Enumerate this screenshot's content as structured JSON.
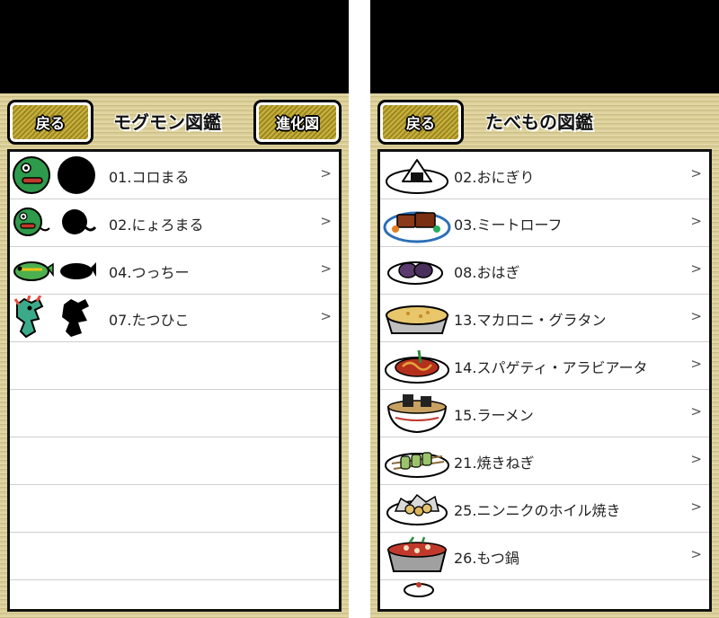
{
  "left_panel": {
    "back_label": "戻る",
    "title": "モグモン図鑑",
    "evolution_label": "進化図",
    "chevron": ">",
    "items": [
      {
        "label": "01.コロまる",
        "icon": "koromaru-icon"
      },
      {
        "label": "02.にょろまる",
        "icon": "nyoromaru-icon"
      },
      {
        "label": "04.つっちー",
        "icon": "tsucchi-icon"
      },
      {
        "label": "07.たつひこ",
        "icon": "tatsuhiko-icon"
      }
    ]
  },
  "right_panel": {
    "back_label": "戻る",
    "title": "たべもの図鑑",
    "chevron": ">",
    "items": [
      {
        "label": "02.おにぎり",
        "icon": "onigiri-icon"
      },
      {
        "label": "03.ミートローフ",
        "icon": "meatloaf-icon"
      },
      {
        "label": "08.おはぎ",
        "icon": "ohagi-icon"
      },
      {
        "label": "13.マカロニ・グラタン",
        "icon": "gratin-icon"
      },
      {
        "label": "14.スパゲティ・アラビアータ",
        "icon": "spaghetti-icon"
      },
      {
        "label": "15.ラーメン",
        "icon": "ramen-icon"
      },
      {
        "label": "21.焼きねぎ",
        "icon": "yakinegi-icon"
      },
      {
        "label": "25.ニンニクのホイル焼き",
        "icon": "garlic-foil-icon"
      },
      {
        "label": "26.もつ鍋",
        "icon": "motsunabe-icon"
      }
    ]
  },
  "colors": {
    "button_gold": "#b29b2b",
    "panel_tan": "#d8cc95",
    "monster_green": "#2e9a4b",
    "silhouette": "#000000"
  }
}
